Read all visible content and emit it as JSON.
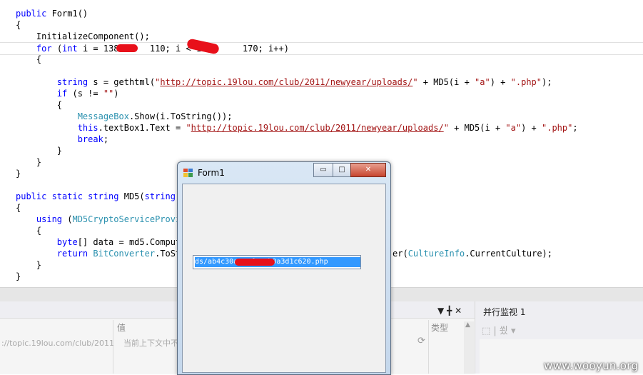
{
  "code": {
    "lines": [
      "public Form1()",
      "{",
      "    InitializeComponent();",
      "    for (int i = 138      110; i < 138      170; i++)",
      "    {",
      "",
      "        string s = gethtml(\"http://topic.19lou.com/club/2011/newyear/uploads/\" + MD5(i + \"a\") + \".php\");",
      "        if (s != \"\")",
      "        {",
      "            MessageBox.Show(i.ToString());",
      "            this.textBox1.Text = \"http://topic.19lou.com/club/2011/newyear/uploads/\" + MD5(i + \"a\") + \".php\";",
      "            break;",
      "        }",
      "    }",
      "}",
      "",
      "public static string MD5(string s",
      "{",
      "    using (MD5CryptoServiceProvic",
      "    {",
      "        byte[] data = md5.Compute",
      "        return BitConverter.ToSti",
      "    }",
      "}"
    ],
    "line14_tail": "er(CultureInfo.CurrentCulture);"
  },
  "bottom_panel": {
    "pin_close_glyphs": "▼ ╋ ✕",
    "col_value": "值",
    "col_type": "类型",
    "row_name": "://topic.19lou.com/club/2011",
    "row_value": "当前上下文中不存",
    "refresh_glyph": "⟳"
  },
  "parallel_watch": {
    "title": "并行监视 1",
    "toolbar_glyphs": "⬚ | 쑀 ▾"
  },
  "form": {
    "title": "Form1",
    "minimize": "▭",
    "maximize": "□",
    "close": "✕",
    "textbox_value": "ds/ab4c30a                 e3f818b0a3d1c620.php"
  },
  "watermark": "www.wooyun.org",
  "colors": {
    "keyword": "#0000ff",
    "type": "#2b91af",
    "string": "#a31515",
    "selection": "#3399ff",
    "redaction": "#e8101a"
  }
}
